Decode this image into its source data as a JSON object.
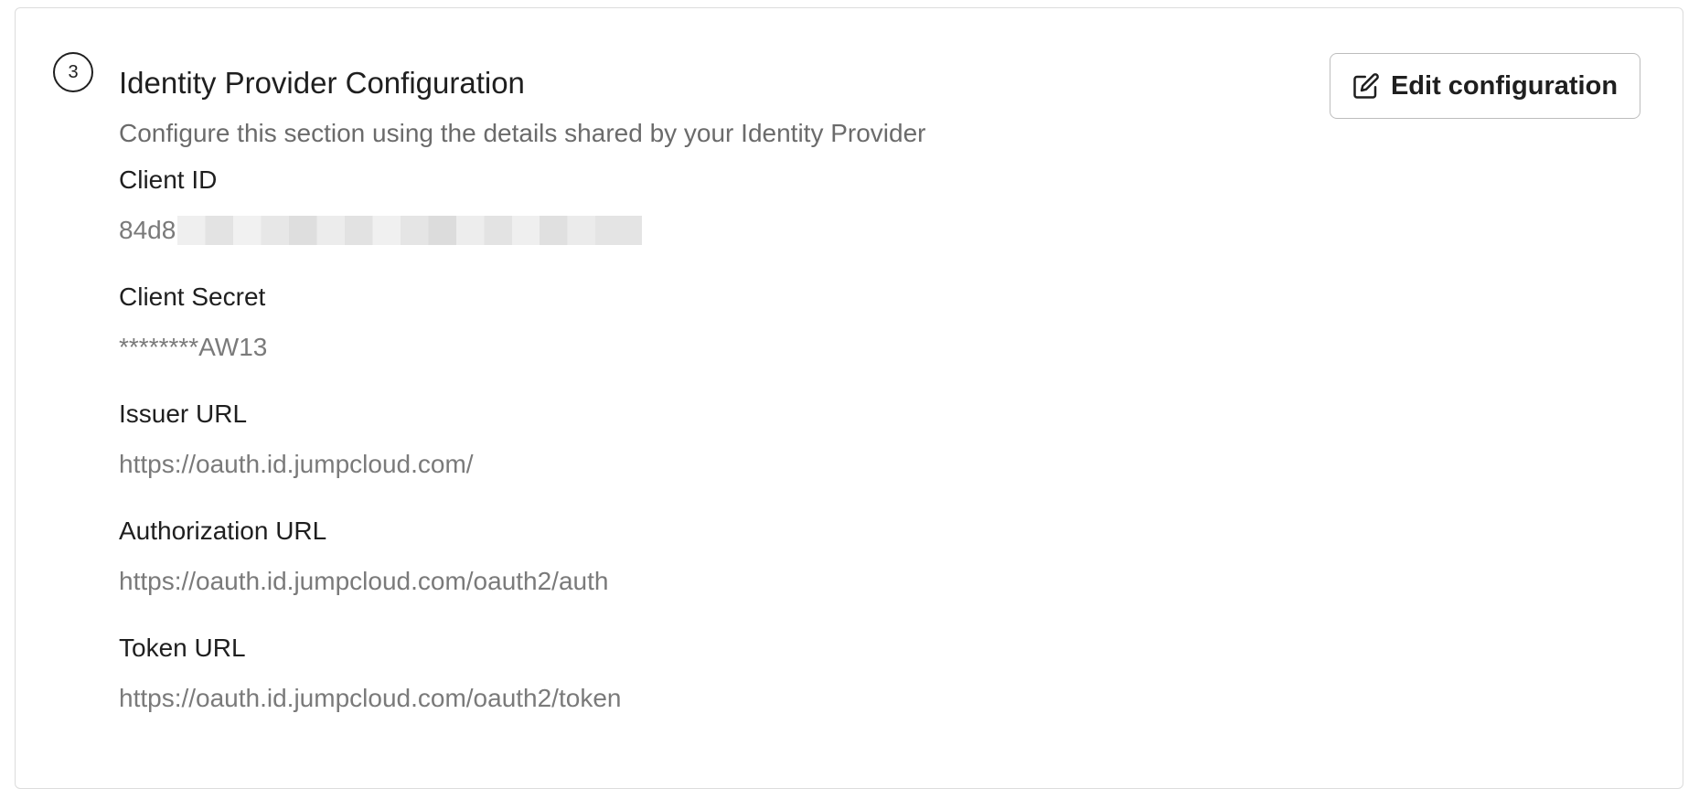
{
  "section": {
    "step_number": "3",
    "title": "Identity Provider Configuration",
    "subtitle": "Configure this section using the details shared by your Identity Provider",
    "edit_button_label": "Edit configuration",
    "edit_icon": "edit-pencil-square-icon"
  },
  "fields": {
    "client_id": {
      "label": "Client ID",
      "value_visible": "84d8",
      "value_redacted": true
    },
    "client_secret": {
      "label": "Client Secret",
      "value": "********AW13"
    },
    "issuer_url": {
      "label": "Issuer URL",
      "value": "https://oauth.id.jumpcloud.com/"
    },
    "authorization_url": {
      "label": "Authorization URL",
      "value": "https://oauth.id.jumpcloud.com/oauth2/auth"
    },
    "token_url": {
      "label": "Token URL",
      "value": "https://oauth.id.jumpcloud.com/oauth2/token"
    }
  }
}
